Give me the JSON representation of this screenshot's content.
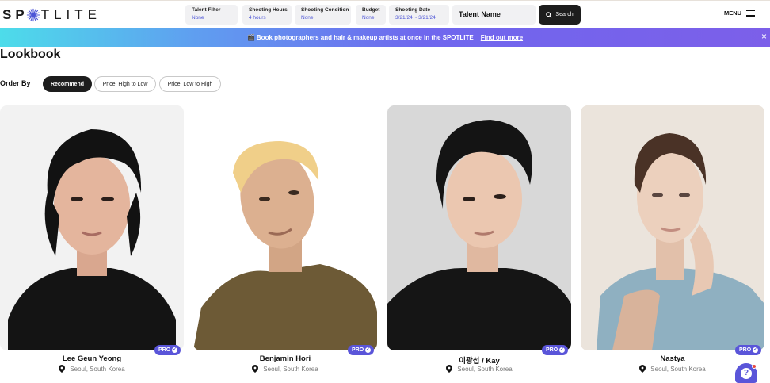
{
  "header": {
    "logo": {
      "left": "SP",
      "right": "TLITE"
    },
    "filters": [
      {
        "label": "Talent Filter",
        "value": "None"
      },
      {
        "label": "Shooting Hours",
        "value": "4 hours"
      },
      {
        "label": "Shooting Condition",
        "value": "None"
      },
      {
        "label": "Budget",
        "value": "None"
      },
      {
        "label": "Shooting Date",
        "value": "3/21/24 ~ 3/21/24"
      }
    ],
    "talent_name_placeholder": "Talent Name",
    "search_label": "Search",
    "menu_label": "MENU"
  },
  "banner": {
    "flag": "🎬",
    "text": "Book photographers and hair & makeup artists at once in the SPOTLITE",
    "link": "Find out more",
    "close": "×"
  },
  "page": {
    "title": "Lookbook",
    "order_by_label": "Order By",
    "sort_options": [
      "Recommend",
      "Price: High to Low",
      "Price: Low to High"
    ],
    "active_sort": "Recommend"
  },
  "talents": [
    {
      "name": "Lee Geun Yeong",
      "location": "Seoul, South Korea",
      "badge": "PRO"
    },
    {
      "name": "Benjamin Hori",
      "location": "Seoul, South Korea",
      "badge": "PRO"
    },
    {
      "name": "이광섭 / Kay",
      "location": "Seoul, South Korea",
      "badge": "PRO"
    },
    {
      "name": "Nastya",
      "location": "Seoul, South Korea",
      "badge": "PRO"
    }
  ],
  "help": {
    "icon_text": "?"
  },
  "colors": {
    "accent": "#5a55d9",
    "filter_value": "#4d55d6",
    "dark_button": "#1d1d1d",
    "banner_start": "#4ddcea",
    "banner_end": "#7c5fe9"
  }
}
